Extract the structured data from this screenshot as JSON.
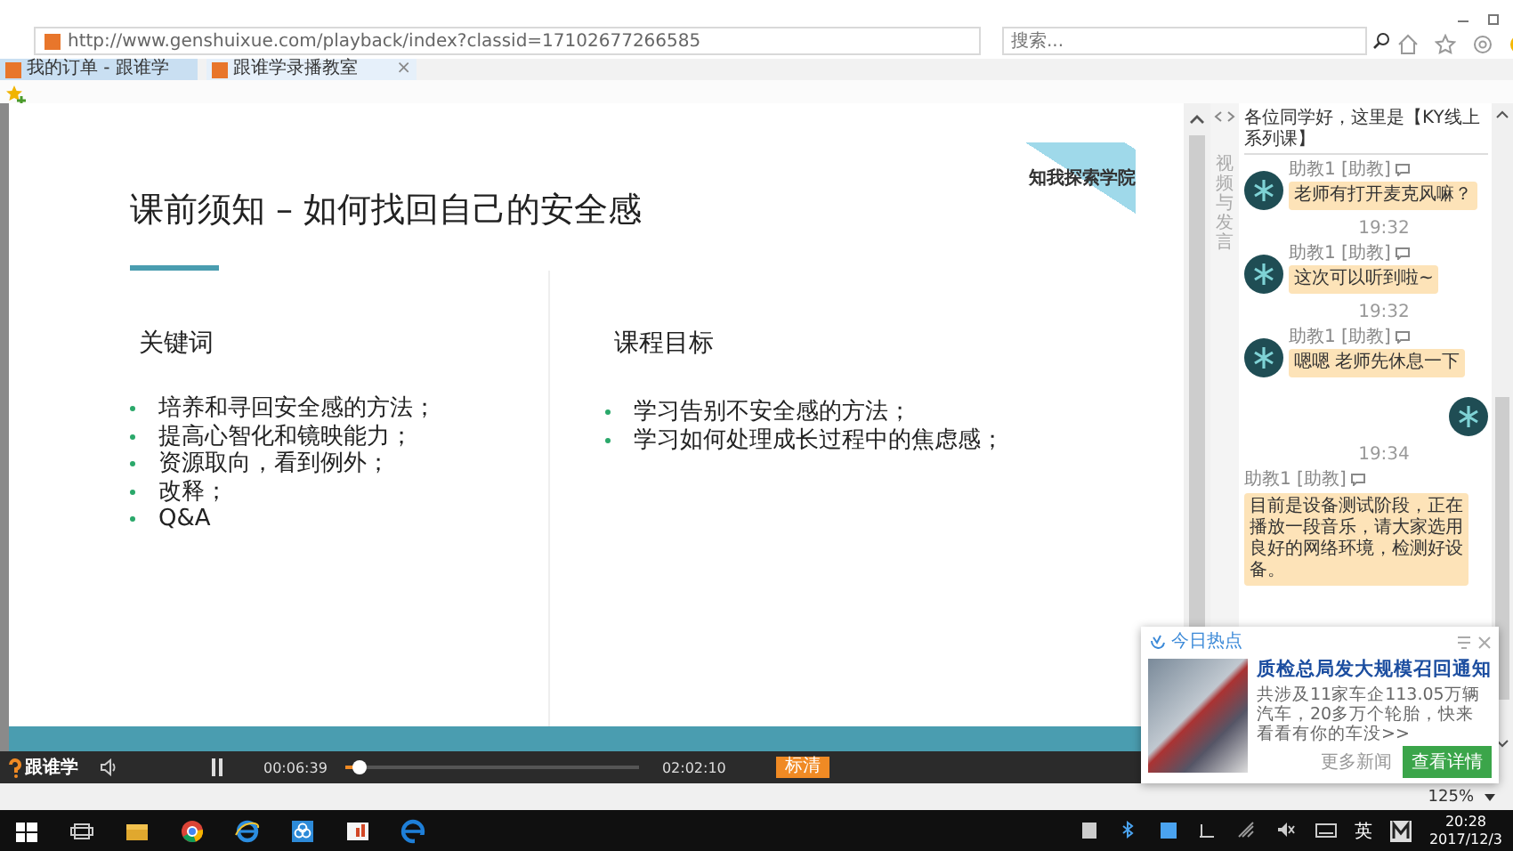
{
  "browser": {
    "url": "http://www.genshuixue.com/playback/index?classid=17102677266585",
    "search": {
      "placeholder": "搜索..."
    },
    "tabs": [
      {
        "label": "我的订单 - 跟谁学",
        "selected": false
      },
      {
        "label": "跟谁学录播教室",
        "selected": true,
        "close": "×"
      }
    ]
  },
  "slide": {
    "title": "课前须知 – 如何找回自己的安全感",
    "logo": "知我探索学院",
    "columns": [
      {
        "heading": "关键词",
        "items": [
          "培养和寻回安全感的方法；",
          "提高心智化和镜映能力；",
          "资源取向，看到例外；",
          "改释；",
          "Q&A"
        ]
      },
      {
        "heading": "课程目标",
        "items": [
          "学习告别不安全感的方法；",
          "学习如何处理成长过程中的焦虑感；"
        ]
      }
    ]
  },
  "player": {
    "brand": "跟谁学",
    "elapsed": "00:06:39",
    "level": 0.05,
    "duration": "02:02:10",
    "quality": "标清"
  },
  "chat": {
    "side_label": "视频与发言",
    "notice": "各位同学好，这里是【KY线上系列课】",
    "messages": [
      {
        "kind": "bubble",
        "name": "助教1 [助教]",
        "text": "老师有打开麦克风嘛？"
      },
      {
        "kind": "time",
        "text": "19:32"
      },
      {
        "kind": "bubble",
        "name": "助教1 [助教]",
        "text": "这次可以听到啦~"
      },
      {
        "kind": "time",
        "text": "19:32"
      },
      {
        "kind": "bubble",
        "name": "助教1 [助教]",
        "text": "嗯嗯 老师先休息一下"
      },
      {
        "kind": "avatar"
      },
      {
        "kind": "time",
        "text": "19:34"
      },
      {
        "kind": "wide",
        "name": "助教1 [助教]",
        "text": "目前是设备测试阶段，正在播放一段音乐，请大家选用良好的网络环境，检测好设备。"
      }
    ]
  },
  "news": {
    "header": "今日热点",
    "title": "质检总局发大规模召回通知",
    "body": "共涉及11家车企113.05万辆汽车，20多万个轮胎，快来看看有你的车没>>",
    "more": "更多新闻",
    "button": "查看详情"
  },
  "status": {
    "zoom": "125%"
  },
  "taskbar": {
    "language": "英",
    "time": "20:28",
    "date": "2017/12/3"
  }
}
